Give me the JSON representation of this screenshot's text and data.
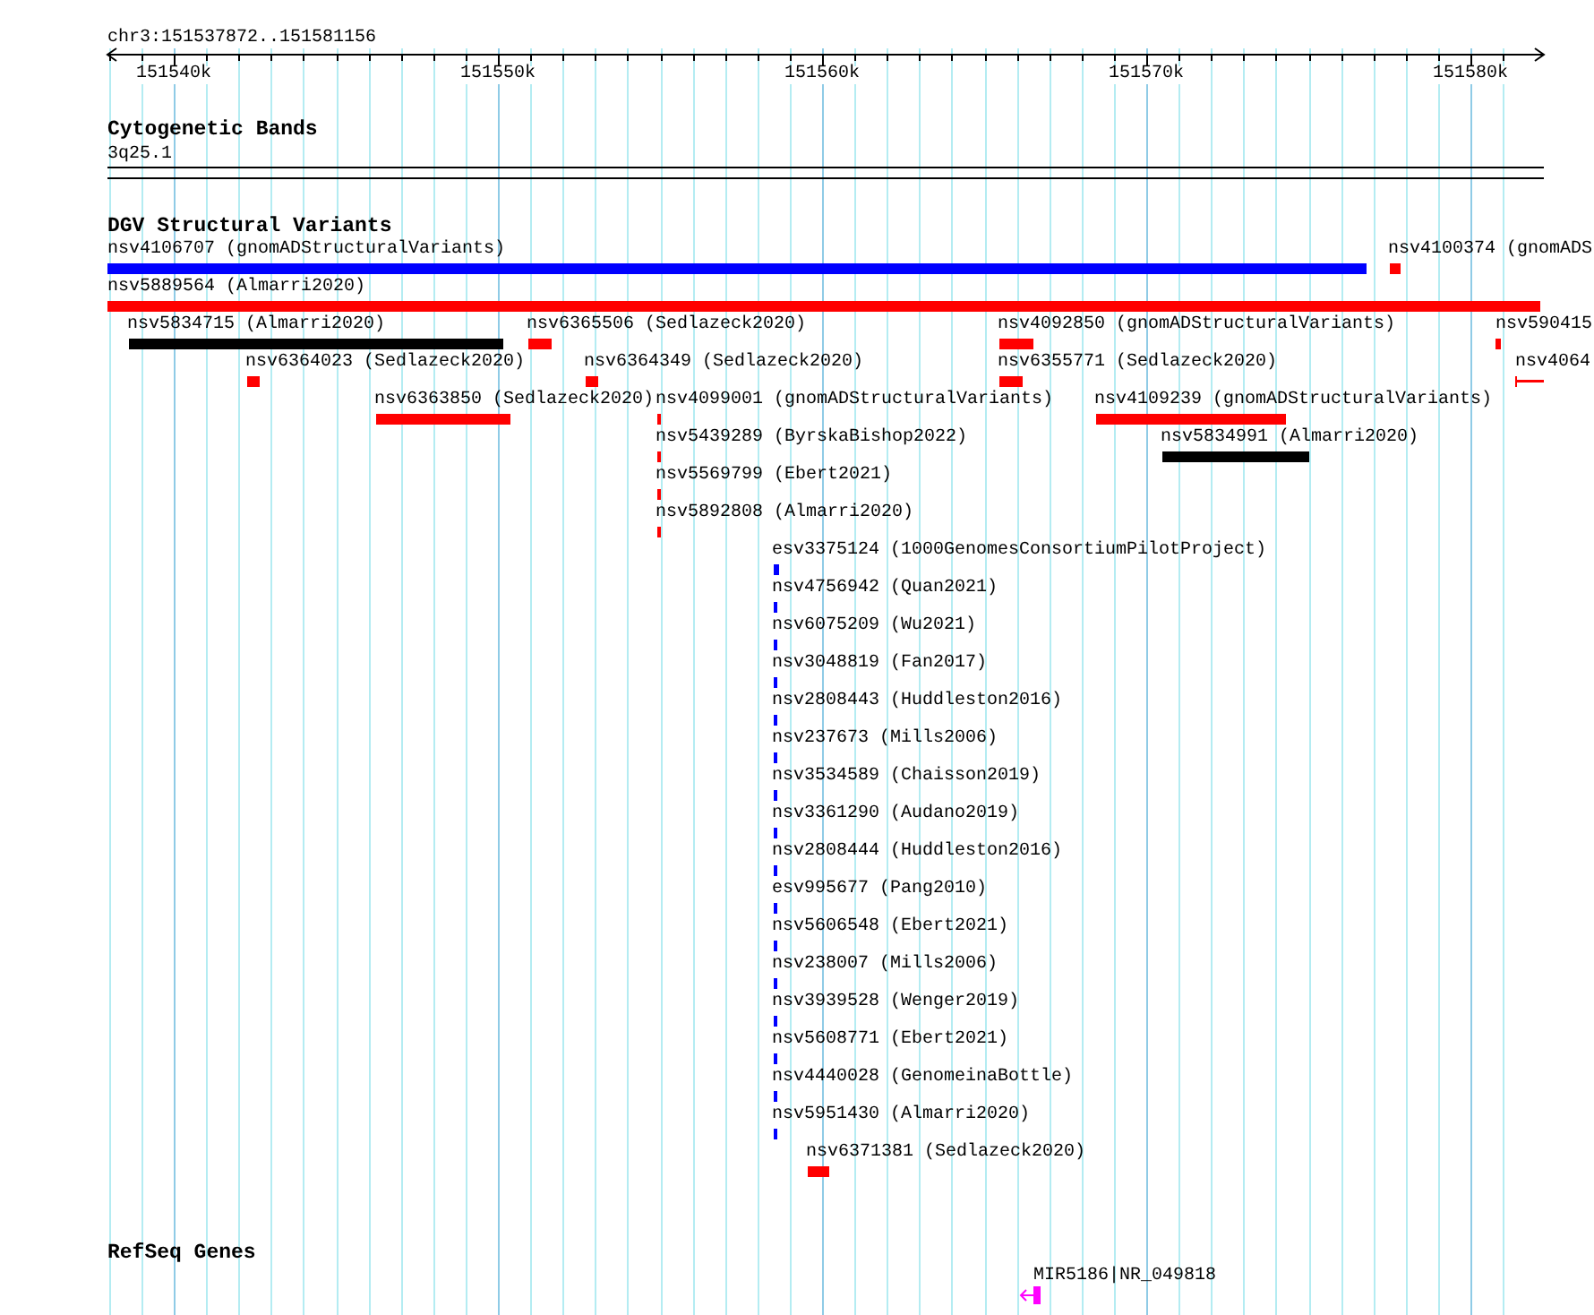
{
  "ruler": {
    "region": "chr3:151537872..151581156",
    "ticks": [
      "151540k",
      "151550k",
      "151560k",
      "151570k",
      "151580k"
    ]
  },
  "cytogenetic_bands": {
    "title": "Cytogenetic Bands",
    "band": "3q25.1"
  },
  "dgv_structural_variants": {
    "title": "DGV Structural Variants",
    "features": [
      {
        "label": "nsv4106707 (gnomADStructuralVariants)",
        "color": "#0000ff",
        "kind": "bar"
      },
      {
        "label": "nsv4100374 (gnomADS",
        "color": "#ff0000",
        "kind": "bar"
      },
      {
        "label": "nsv5889564 (Almarri2020)",
        "color": "#ff0000",
        "kind": "bar"
      },
      {
        "label": "nsv5834715 (Almarri2020)",
        "color": "#000000",
        "kind": "bar"
      },
      {
        "label": "nsv6365506 (Sedlazeck2020)",
        "color": "#ff0000",
        "kind": "bar"
      },
      {
        "label": "nsv4092850 (gnomADStructuralVariants)",
        "color": "#ff0000",
        "kind": "bar"
      },
      {
        "label": "nsv590415",
        "color": "#ff0000",
        "kind": "bar"
      },
      {
        "label": "nsv6364023 (Sedlazeck2020)",
        "color": "#ff0000",
        "kind": "bar"
      },
      {
        "label": "nsv6364349 (Sedlazeck2020)",
        "color": "#ff0000",
        "kind": "bar"
      },
      {
        "label": "nsv6355771 (Sedlazeck2020)",
        "color": "#ff0000",
        "kind": "bar"
      },
      {
        "label": "nsv4064",
        "color": "#ff0000",
        "kind": "whisker"
      },
      {
        "label": "nsv6363850 (Sedlazeck2020)",
        "color": "#ff0000",
        "kind": "bar"
      },
      {
        "label": "nsv4099001 (gnomADStructuralVariants)",
        "color": "#ff0000",
        "kind": "bar"
      },
      {
        "label": "nsv4109239 (gnomADStructuralVariants)",
        "color": "#ff0000",
        "kind": "bar"
      },
      {
        "label": "nsv5439289 (ByrskaBishop2022)",
        "color": "#ff0000",
        "kind": "bar"
      },
      {
        "label": "nsv5834991 (Almarri2020)",
        "color": "#000000",
        "kind": "bar"
      },
      {
        "label": "nsv5569799 (Ebert2021)",
        "color": "#ff0000",
        "kind": "bar"
      },
      {
        "label": "nsv5892808 (Almarri2020)",
        "color": "#ff0000",
        "kind": "bar"
      },
      {
        "label": "esv3375124 (1000GenomesConsortiumPilotProject)",
        "color": "#0000ff",
        "kind": "bar"
      },
      {
        "label": "nsv4756942 (Quan2021)",
        "color": "#0000ff",
        "kind": "bar"
      },
      {
        "label": "nsv6075209 (Wu2021)",
        "color": "#0000ff",
        "kind": "bar"
      },
      {
        "label": "nsv3048819 (Fan2017)",
        "color": "#0000ff",
        "kind": "bar"
      },
      {
        "label": "nsv2808443 (Huddleston2016)",
        "color": "#0000ff",
        "kind": "bar"
      },
      {
        "label": "nsv237673 (Mills2006)",
        "color": "#0000ff",
        "kind": "bar"
      },
      {
        "label": "nsv3534589 (Chaisson2019)",
        "color": "#0000ff",
        "kind": "bar"
      },
      {
        "label": "nsv3361290 (Audano2019)",
        "color": "#0000ff",
        "kind": "bar"
      },
      {
        "label": "nsv2808444 (Huddleston2016)",
        "color": "#0000ff",
        "kind": "bar"
      },
      {
        "label": "esv995677 (Pang2010)",
        "color": "#0000ff",
        "kind": "bar"
      },
      {
        "label": "nsv5606548 (Ebert2021)",
        "color": "#0000ff",
        "kind": "bar"
      },
      {
        "label": "nsv238007 (Mills2006)",
        "color": "#0000ff",
        "kind": "bar"
      },
      {
        "label": "nsv3939528 (Wenger2019)",
        "color": "#0000ff",
        "kind": "bar"
      },
      {
        "label": "nsv5608771 (Ebert2021)",
        "color": "#0000ff",
        "kind": "bar"
      },
      {
        "label": "nsv4440028 (GenomeinaBottle)",
        "color": "#0000ff",
        "kind": "bar"
      },
      {
        "label": "nsv5951430 (Almarri2020)",
        "color": "#0000ff",
        "kind": "bar"
      },
      {
        "label": "nsv6371381 (Sedlazeck2020)",
        "color": "#ff0000",
        "kind": "bar"
      }
    ]
  },
  "refseq_genes": {
    "title": "RefSeq Genes",
    "genes": [
      {
        "label": "MIR5186|NR_049818",
        "kind": "reverse"
      }
    ]
  }
}
